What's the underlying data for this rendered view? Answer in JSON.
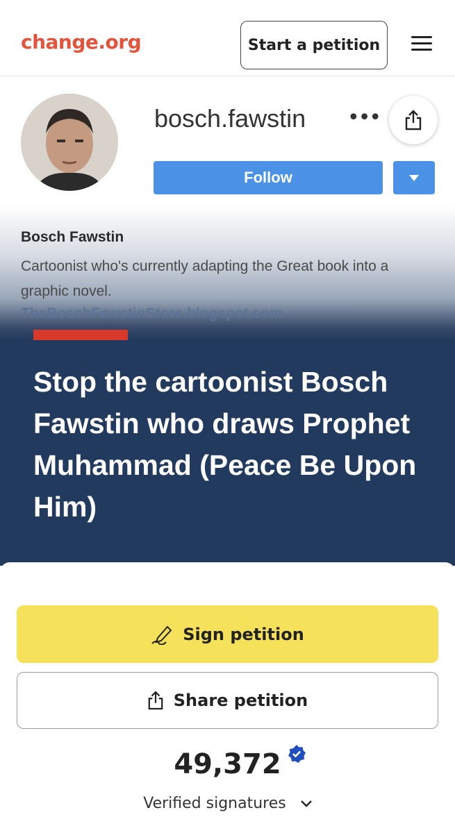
{
  "header": {
    "logo": "change.org",
    "start_label": "Start a petition",
    "menu_icon": "hamburger-menu-icon"
  },
  "profile_screenshot": {
    "username": "bosch.fawstin",
    "more": "•••",
    "follow_label": "Follow",
    "bio_name": "Bosch Fawstin",
    "bio_text": "Cartoonist who's currently adapting the Great book into a graphic novel.",
    "bio_link": "TheBoschFawstinStore.blogspot.com"
  },
  "petition": {
    "title": "Stop the cartoonist Bosch Fawstin who draws Prophet Muhammad (Peace Be Upon Him)",
    "sign_label": "Sign petition",
    "share_label": "Share petition",
    "signature_count": "49,372",
    "signature_label": "Verified signatures"
  },
  "colors": {
    "brand": "#e4543c",
    "hero_bg": "#223a5e",
    "sign_button": "#f5e25a",
    "follow_blue": "#4b92e6",
    "accent_red": "#d9392b",
    "verified_blue": "#1f4fbf"
  }
}
